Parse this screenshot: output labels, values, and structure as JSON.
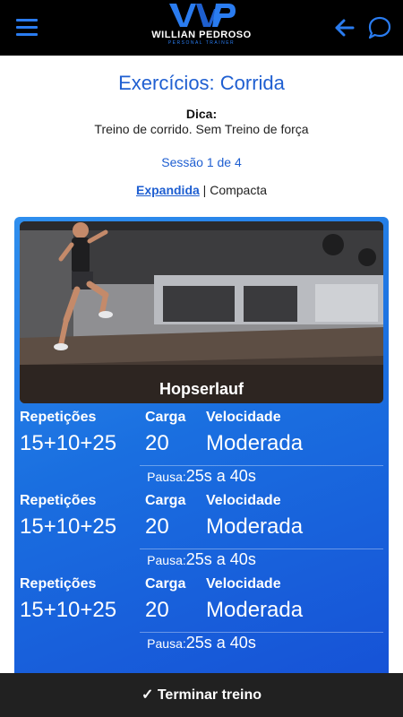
{
  "header": {
    "logo_name": "WILLIAN PEDROSO",
    "logo_sub": "PERSONAL TRAINER",
    "brand_color": "#2a7cf0"
  },
  "page": {
    "title": "Exercícios: Corrida",
    "tip_label": "Dica:",
    "tip_text": "Treino de corrido. Sem Treino de força",
    "session": "Sessão 1 de 4",
    "view_active": "Expandida",
    "view_separator": " | ",
    "view_other": "Compacta"
  },
  "exercise": {
    "name": "Hopserlauf",
    "sets": [
      {
        "reps_label": "Repetições",
        "reps": "15+10+25",
        "load_label": "Carga",
        "load": "20",
        "speed_label": "Velocidade",
        "speed": "Moderada",
        "pause_label": "Pausa:",
        "pause": "25s a 40s"
      },
      {
        "reps_label": "Repetições",
        "reps": "15+10+25",
        "load_label": "Carga",
        "load": "20",
        "speed_label": "Velocidade",
        "speed": "Moderada",
        "pause_label": "Pausa:",
        "pause": "25s a 40s"
      },
      {
        "reps_label": "Repetições",
        "reps": "15+10+25",
        "load_label": "Carga",
        "load": "20",
        "speed_label": "Velocidade",
        "speed": "Moderada",
        "pause_label": "Pausa:",
        "pause": "25s a 40s"
      }
    ]
  },
  "footer": {
    "finish_label": "✓ Terminar treino"
  },
  "icons": [
    "menu-icon",
    "back-arrow-icon",
    "chat-icon"
  ]
}
